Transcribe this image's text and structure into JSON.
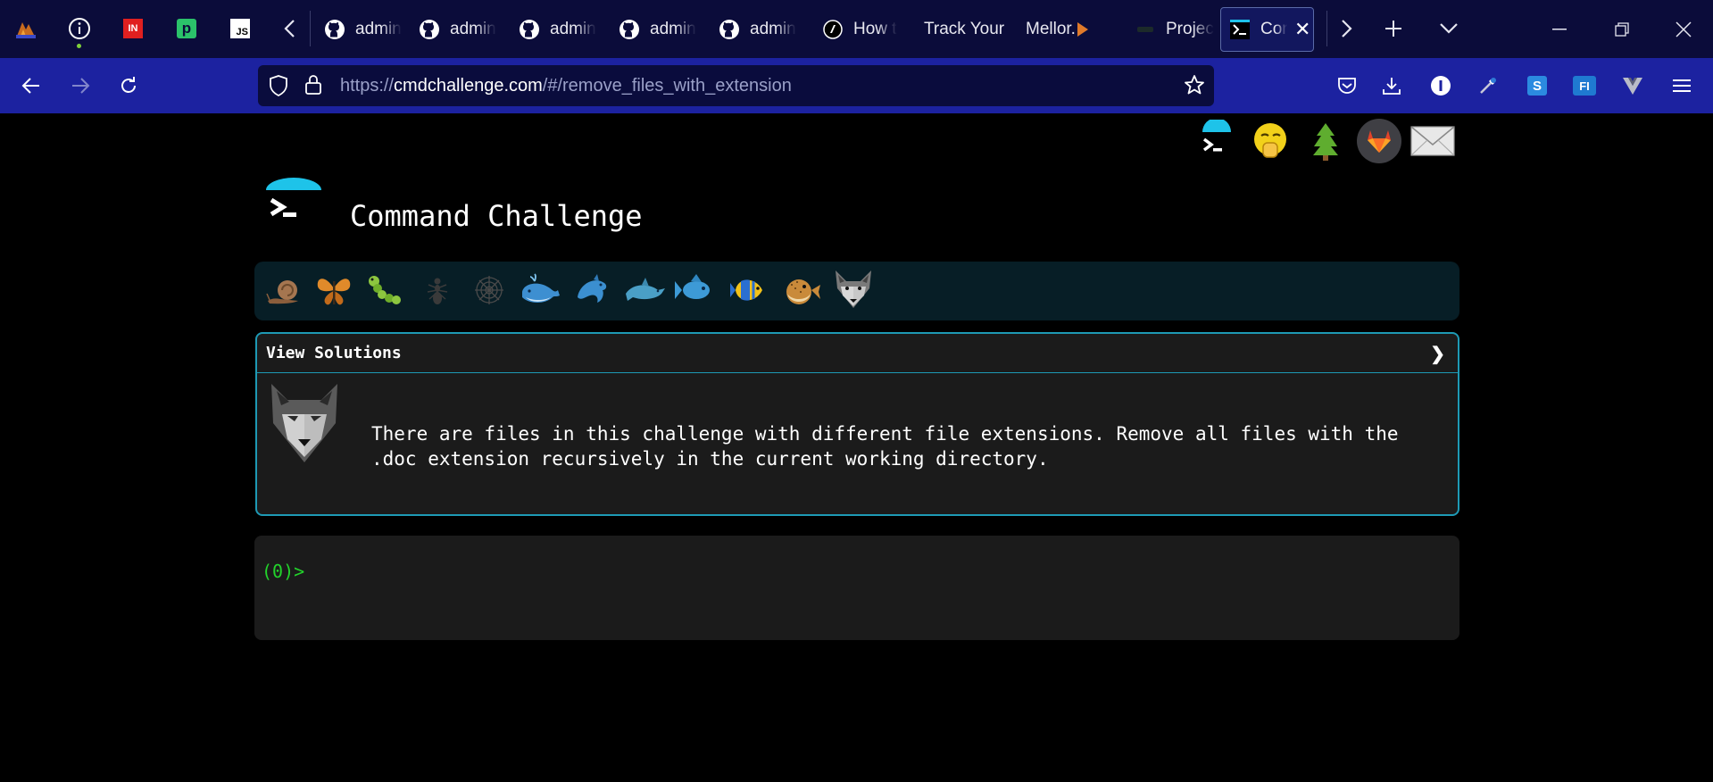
{
  "browser": {
    "pinned_tabs": [
      {
        "name": "pinned-tab-mountain",
        "icon": "mountain-logo-icon"
      },
      {
        "name": "pinned-tab-info",
        "icon": "info-icon"
      },
      {
        "name": "pinned-tab-in",
        "icon": "in-logo-icon",
        "label": "IN"
      },
      {
        "name": "pinned-tab-p",
        "icon": "p-logo-icon",
        "label": "p"
      },
      {
        "name": "pinned-tab-js",
        "icon": "js-logo-icon",
        "label": "JS"
      }
    ],
    "tabs": [
      {
        "title": "admin",
        "icon": "github-icon"
      },
      {
        "title": "admin",
        "icon": "github-icon"
      },
      {
        "title": "admin",
        "icon": "github-icon"
      },
      {
        "title": "admin",
        "icon": "github-icon"
      },
      {
        "title": "admin",
        "icon": "github-icon"
      },
      {
        "title": "How t",
        "icon": "site-icon"
      },
      {
        "title": "Track Your",
        "icon": "none"
      },
      {
        "title": "Mellor.",
        "icon": "mellor-icon"
      },
      {
        "title": "Projec",
        "icon": "project-icon"
      },
      {
        "title": "Cor",
        "icon": "terminal-icon",
        "active": true
      }
    ],
    "url": {
      "prefix": "https://",
      "host": "cmdchallenge.com",
      "path": "/#/remove_files_with_extension"
    },
    "toolbar_icons": [
      "pocket-icon",
      "download-icon",
      "account-icon",
      "eyedropper-icon",
      "s-extension-icon",
      "fi-extension-icon",
      "vuejs-icon",
      "menu-icon"
    ],
    "in_label": "IN",
    "p_label": "p",
    "js_label": "JS",
    "s_label": "S",
    "fi_label": "FI"
  },
  "page": {
    "site_title": "Command Challenge",
    "social_links": [
      "terminal-logo-link",
      "hushed-emoji-link",
      "tree-link",
      "gitlab-link",
      "mail-link"
    ],
    "levels": [
      "snail",
      "butterfly",
      "caterpillar",
      "ant",
      "spider-web",
      "whale",
      "dolphin",
      "dolphin-2",
      "fish",
      "tropical-fish",
      "blowfish",
      "wolf"
    ],
    "panel": {
      "title": "View Solutions",
      "chevron": "❯",
      "description": "There are files in this challenge with different file extensions. Remove all files with the .doc extension recursively in the current working directory."
    },
    "terminal": {
      "prompt": "(0)>"
    }
  },
  "colors": {
    "tabbar_bg": "#0b0c3a",
    "navbar_bg": "#1c22a0",
    "accent": "#1e9ab5",
    "prompt_green": "#22d32b",
    "logo_cyan": "#1ec3e9"
  }
}
